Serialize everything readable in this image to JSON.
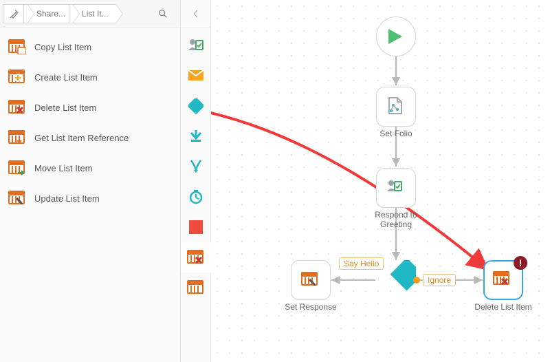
{
  "breadcrumb": {
    "root": "🛠",
    "b1": "Share...",
    "b2": "List It..."
  },
  "sidebar": [
    {
      "label": "Copy List Item",
      "icon": "list-copy"
    },
    {
      "label": "Create List Item",
      "icon": "list-create"
    },
    {
      "label": "Delete List Item",
      "icon": "list-delete"
    },
    {
      "label": "Get List Item Reference",
      "icon": "list-ref"
    },
    {
      "label": "Move List Item",
      "icon": "list-move"
    },
    {
      "label": "Update List Item",
      "icon": "list-update"
    }
  ],
  "miniPalette": [
    {
      "name": "user-task",
      "icon": "usertask"
    },
    {
      "name": "mail",
      "icon": "mail"
    },
    {
      "name": "decision",
      "icon": "decision"
    },
    {
      "name": "goto",
      "icon": "goto"
    },
    {
      "name": "merge",
      "icon": "merge"
    },
    {
      "name": "timer",
      "icon": "timer"
    },
    {
      "name": "stop",
      "icon": "stop"
    },
    {
      "name": "list-delete",
      "icon": "list-delete"
    },
    {
      "name": "list",
      "icon": "list"
    }
  ],
  "nodes": {
    "start": {
      "label": ""
    },
    "setFolio": {
      "label": "Set Folio"
    },
    "respond": {
      "label": "Respond to Greeting"
    },
    "setResponse": {
      "label": "Set Response"
    },
    "deleteItem": {
      "label": "Delete List Item"
    }
  },
  "edges": {
    "sayHello": "Say Hello",
    "ignore": "Ignore"
  },
  "errBadge": "!"
}
